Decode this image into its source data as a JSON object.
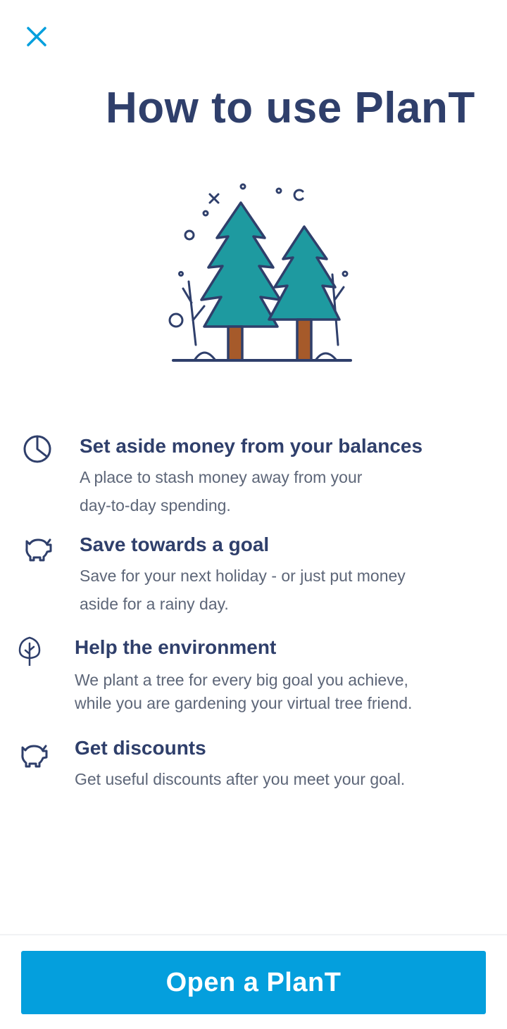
{
  "header": {
    "close_icon": "close-icon",
    "title": "How to use PlanT"
  },
  "illustration": {
    "icon": "pine-trees-illustration",
    "colors": {
      "outline": "#2f3f6b",
      "foliage": "#1e9aa0",
      "trunk": "#a65a2a"
    }
  },
  "features": [
    {
      "icon": "pie-chart-icon",
      "title": "Set aside money from your balances",
      "desc_line1": "A place to stash money away from your",
      "desc_line2": "day-to-day spending."
    },
    {
      "icon": "piggy-bank-icon",
      "title": "Save towards a goal",
      "desc_line1": "Save for your next holiday - or just put money",
      "desc_line2": "aside for a rainy day."
    },
    {
      "icon": "tree-icon",
      "title": "Help the environment",
      "desc_line1": "We plant a tree for every big goal you achieve,",
      "desc_line2": "while you are gardening your virtual tree friend."
    },
    {
      "icon": "piggy-bank-icon",
      "title": "Get discounts",
      "desc_line1": "Get useful discounts after you meet your goal."
    }
  ],
  "footer": {
    "button_label": "Open a PlanT"
  },
  "colors": {
    "accent": "#049fdd",
    "heading": "#2f3f6b",
    "body_text": "#5d6678"
  }
}
